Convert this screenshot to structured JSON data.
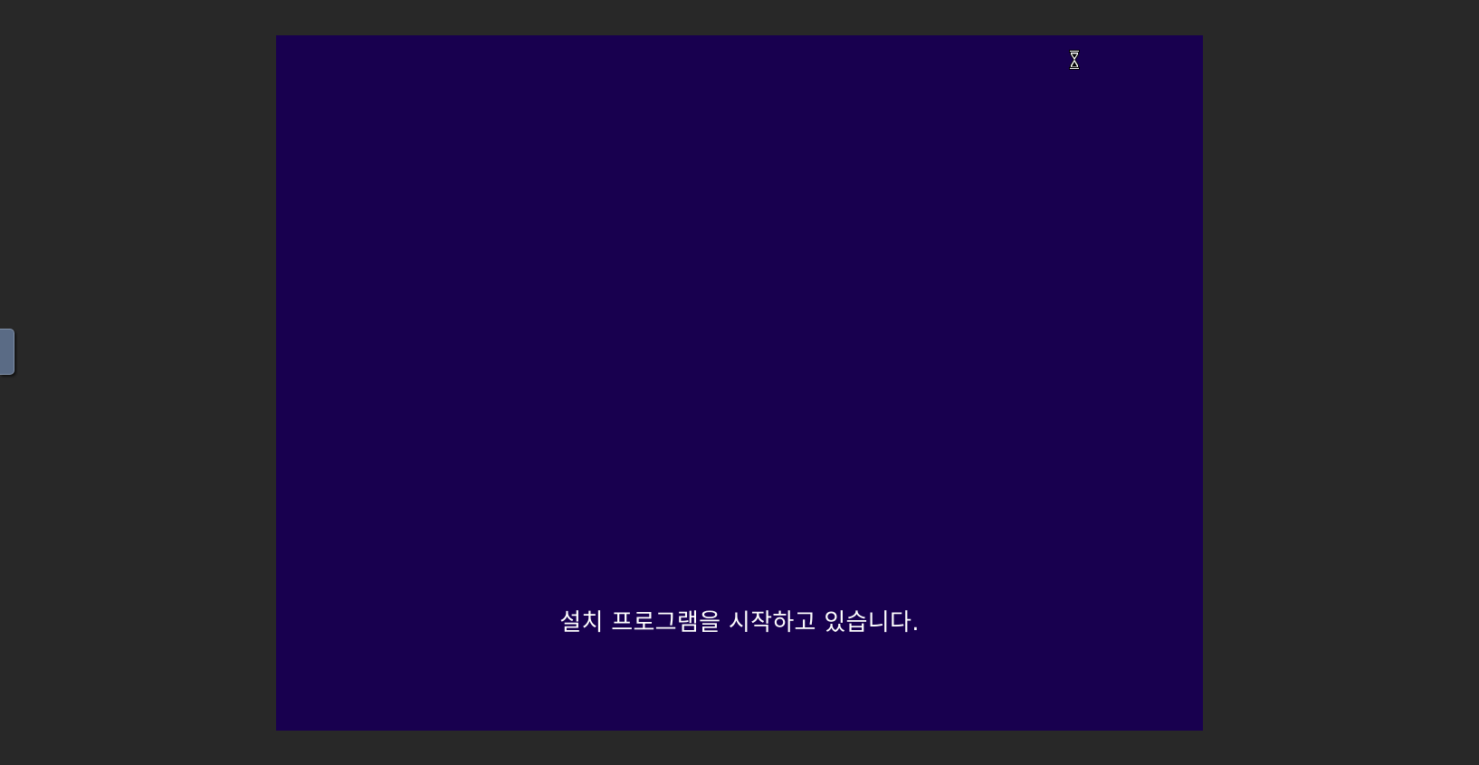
{
  "viewer": {
    "background": "#282828"
  },
  "side_handle": {
    "color": "#5a6b85"
  },
  "screen": {
    "background": "#18004f",
    "status_message": "설치 프로그램을 시작하고 있습니다.",
    "cursor_icon": "hourglass-icon"
  }
}
